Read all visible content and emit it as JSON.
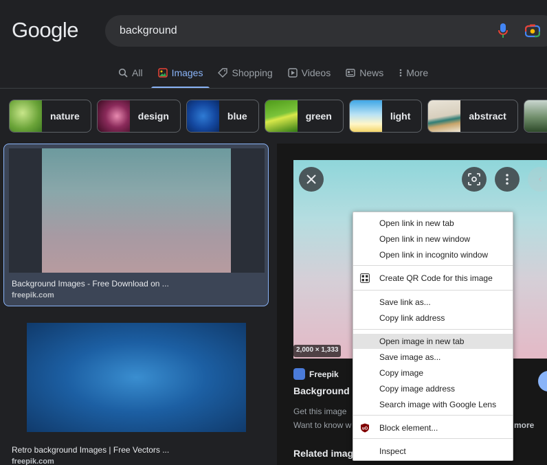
{
  "header": {
    "logo": "Google",
    "search_value": "background"
  },
  "tabs": [
    {
      "label": "All",
      "icon": "search-icon"
    },
    {
      "label": "Images",
      "icon": "images-icon",
      "active": true
    },
    {
      "label": "Shopping",
      "icon": "tag-icon"
    },
    {
      "label": "Videos",
      "icon": "play-icon"
    },
    {
      "label": "News",
      "icon": "news-icon"
    },
    {
      "label": "More",
      "icon": "more-vert-icon"
    }
  ],
  "chips": [
    {
      "label": "nature"
    },
    {
      "label": "design"
    },
    {
      "label": "blue"
    },
    {
      "label": "green"
    },
    {
      "label": "light"
    },
    {
      "label": "abstract"
    }
  ],
  "results": [
    {
      "title": "Background Images - Free Download on ...",
      "source": "freepik.com"
    },
    {
      "title": "Retro background Images | Free Vectors ...",
      "source": "freepik.com"
    }
  ],
  "preview": {
    "dimensions": "2,000 × 1,333",
    "source": "Freepik",
    "title": "Background",
    "desc1": "Get this image",
    "desc2": "Want to know w",
    "more": "more",
    "related": "Related imag"
  },
  "context_menu": [
    "Open link in new tab",
    "Open link in new window",
    "Open link in incognito window",
    "Create QR Code for this image",
    "Save link as...",
    "Copy link address",
    "Open image in new tab",
    "Save image as...",
    "Copy image",
    "Copy image address",
    "Search image with Google Lens",
    "Block element...",
    "Inspect"
  ]
}
